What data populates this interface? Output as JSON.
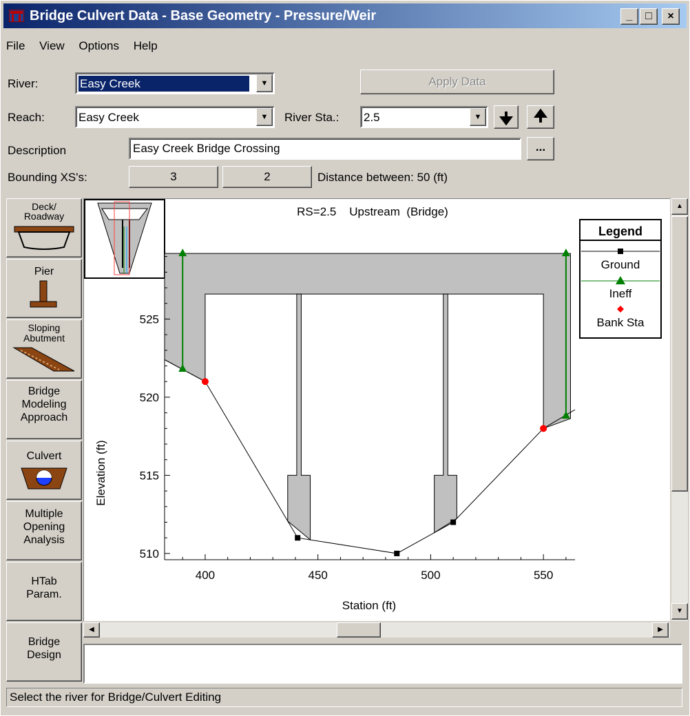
{
  "window": {
    "title": "Bridge Culvert Data - Base Geometry - Pressure/Weir",
    "minimize": "_",
    "maximize": "□",
    "close": "×"
  },
  "menu": [
    "File",
    "View",
    "Options",
    "Help"
  ],
  "form": {
    "river_label": "River:",
    "river_value": "Easy Creek",
    "reach_label": "Reach:",
    "reach_value": "Easy Creek",
    "river_sta_label": "River Sta.:",
    "river_sta_value": "2.5",
    "apply_label": "Apply Data",
    "description_label": "Description",
    "description_value": "Easy Creek Bridge Crossing",
    "ellipsis_label": "...",
    "bounding_label": "Bounding XS's:",
    "bounding_1": "3",
    "bounding_2": "2",
    "distance_text": "Distance between: 50 (ft)"
  },
  "side_buttons": [
    "Deck/\nRoadway",
    "Pier",
    "Sloping\nAbutment",
    "Bridge\nModeling\nApproach",
    "Culvert",
    "Multiple\nOpening\nAnalysis",
    "HTab\nParam.",
    "Bridge\nDesign"
  ],
  "status": "Select the river for Bridge/Culvert Editing",
  "icons": {
    "down_arrow": "down-arrow-icon",
    "up_arrow": "up-arrow-icon",
    "app_icon": "hec-ras-icon"
  },
  "colors": {
    "title_start": "#0a246a",
    "title_end": "#a6caf0",
    "fill": "#c0c0c0",
    "ineff": "#008000",
    "bank": "#ff0000",
    "ground": "#000000"
  },
  "chart_data": {
    "type": "line",
    "title": "RS=2.5    Upstream  (Bridge)",
    "xlabel": "Station (ft)",
    "ylabel": "Elevation (ft)",
    "xlim": [
      382,
      564
    ],
    "ylim": [
      509.6,
      529.6
    ],
    "xticks": [
      400,
      450,
      500,
      550
    ],
    "yticks": [
      510,
      515,
      520,
      525
    ],
    "legend": {
      "title": "Legend",
      "placement": "top-right",
      "entries": [
        "Ground",
        "Ineff",
        "Bank Sta"
      ]
    },
    "series": [
      {
        "name": "Ground",
        "points": [
          [
            382,
            522.4
          ],
          [
            400,
            521
          ],
          [
            441,
            511
          ],
          [
            485,
            510
          ],
          [
            510,
            512
          ],
          [
            550,
            518
          ],
          [
            564,
            519.2
          ]
        ]
      },
      {
        "name": "Ineff",
        "points": [
          [
            390,
            521.8
          ],
          [
            390,
            529.2
          ],
          [
            560,
            518.8
          ],
          [
            560,
            529.2
          ]
        ]
      },
      {
        "name": "Bank Sta",
        "points": [
          [
            400,
            521
          ],
          [
            550,
            518
          ]
        ]
      }
    ],
    "deck": {
      "high_chord": 529.2,
      "low_chord": 526.6,
      "left_sta": 382,
      "right_sta": 562
    },
    "piers": [
      {
        "center": 441.6,
        "upper_width": 2,
        "footing_width": 10,
        "footing_top": 515
      },
      {
        "center": 506.6,
        "upper_width": 2,
        "footing_width": 10,
        "footing_top": 515
      }
    ],
    "abutments": {
      "left_face": 400,
      "right_face": 550
    }
  }
}
